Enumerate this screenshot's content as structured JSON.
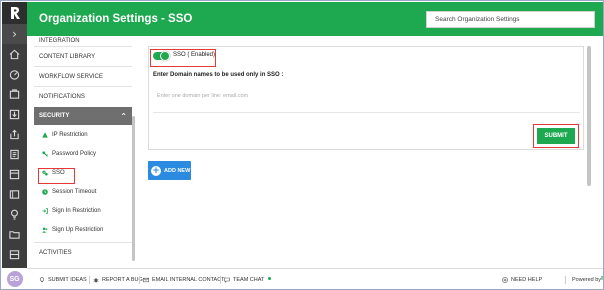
{
  "header": {
    "title": "Organization Settings - SSO",
    "search_placeholder": "Search Organization Settings"
  },
  "rail": {
    "logo_icon": "rfpio-logo-icon",
    "expand_icon": "chevron-right-icon",
    "icons": [
      "home-icon",
      "dashboard-icon",
      "projects-icon",
      "import-icon",
      "export-icon",
      "library-icon",
      "answers-icon",
      "window-icon",
      "bulb-icon",
      "folder-icon",
      "archive-icon"
    ]
  },
  "nav": {
    "items_top": [
      "INTEGRATION",
      "CONTENT LIBRARY",
      "WORKFLOW SERVICE",
      "NOTIFICATIONS"
    ],
    "section": "SECURITY",
    "sub_items": [
      {
        "label": "IP Restriction",
        "icon": "warning-icon"
      },
      {
        "label": "Password Policy",
        "icon": "key-icon"
      },
      {
        "label": "SSO",
        "icon": "gears-icon"
      },
      {
        "label": "Session Timeout",
        "icon": "clock-icon"
      },
      {
        "label": "Sign In Restriction",
        "icon": "sign-in-icon"
      },
      {
        "label": "Sign Up Restriction",
        "icon": "user-plus-icon"
      }
    ],
    "activities": "ACTIVITIES"
  },
  "sso": {
    "toggle_label": "SSO ( Enabled)",
    "domain_label": "Enter Domain names to be used only in SSO :",
    "domain_placeholder": "Enter one domain per line: email.com",
    "submit_label": "SUBMIT",
    "add_new_label": "ADD NEW"
  },
  "footer": {
    "avatar_initials": "SG",
    "links": [
      "SUBMIT IDEAS",
      "REPORT A BUG",
      "EMAIL INTERNAL CONTACT",
      "TEAM CHAT"
    ],
    "need_help": "NEED HELP",
    "powered_by": "Powered by",
    "brand": "rfpio"
  },
  "colors": {
    "brand_green": "#1ea84f",
    "rail_dark": "#3d3d3d",
    "highlight_red": "#e53935",
    "add_blue": "#2b8be0"
  }
}
